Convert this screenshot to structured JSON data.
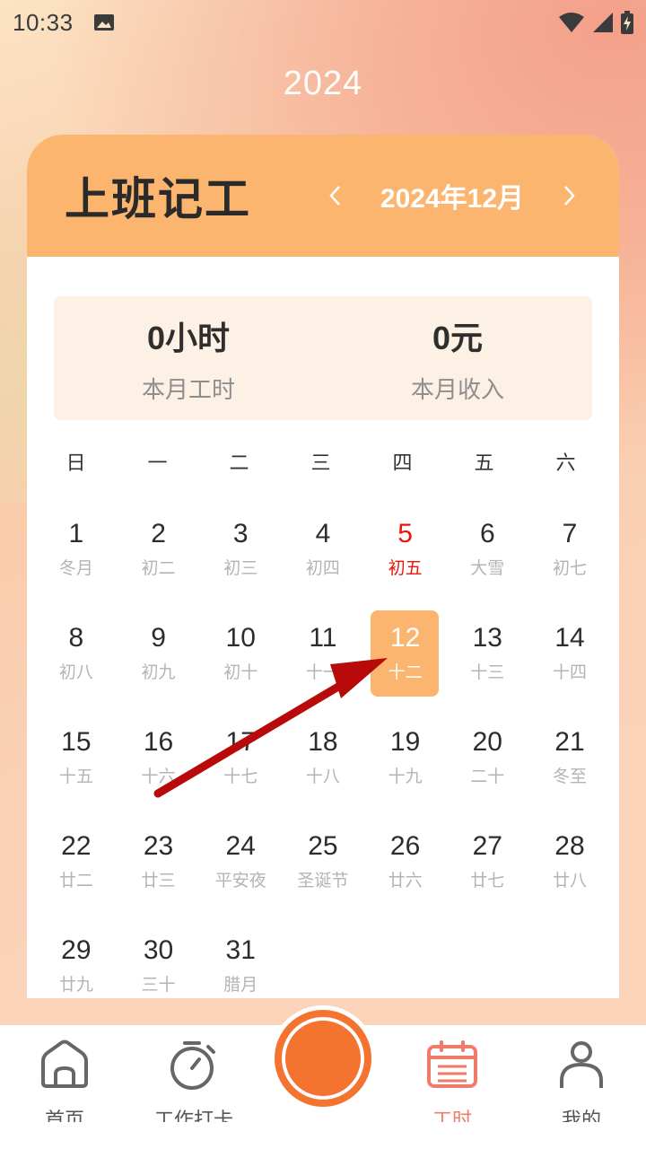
{
  "status": {
    "time": "10:33"
  },
  "year": "2024",
  "header": {
    "title": "上班记工",
    "month": "2024年12月"
  },
  "summary": {
    "hours_value": "0小时",
    "hours_label": "本月工时",
    "income_value": "0元",
    "income_label": "本月收入"
  },
  "weekdays": [
    "日",
    "一",
    "二",
    "三",
    "四",
    "五",
    "六"
  ],
  "days": [
    {
      "n": "1",
      "l": "冬月"
    },
    {
      "n": "2",
      "l": "初二"
    },
    {
      "n": "3",
      "l": "初三"
    },
    {
      "n": "4",
      "l": "初四"
    },
    {
      "n": "5",
      "l": "初五",
      "holiday": true
    },
    {
      "n": "6",
      "l": "大雪"
    },
    {
      "n": "7",
      "l": "初七"
    },
    {
      "n": "8",
      "l": "初八"
    },
    {
      "n": "9",
      "l": "初九"
    },
    {
      "n": "10",
      "l": "初十"
    },
    {
      "n": "11",
      "l": "十一"
    },
    {
      "n": "12",
      "l": "十二",
      "selected": true
    },
    {
      "n": "13",
      "l": "十三"
    },
    {
      "n": "14",
      "l": "十四"
    },
    {
      "n": "15",
      "l": "十五"
    },
    {
      "n": "16",
      "l": "十六"
    },
    {
      "n": "17",
      "l": "十七"
    },
    {
      "n": "18",
      "l": "十八"
    },
    {
      "n": "19",
      "l": "十九"
    },
    {
      "n": "20",
      "l": "二十"
    },
    {
      "n": "21",
      "l": "冬至"
    },
    {
      "n": "22",
      "l": "廿二"
    },
    {
      "n": "23",
      "l": "廿三"
    },
    {
      "n": "24",
      "l": "平安夜"
    },
    {
      "n": "25",
      "l": "圣诞节"
    },
    {
      "n": "26",
      "l": "廿六"
    },
    {
      "n": "27",
      "l": "廿七"
    },
    {
      "n": "28",
      "l": "廿八"
    },
    {
      "n": "29",
      "l": "廿九"
    },
    {
      "n": "30",
      "l": "三十"
    },
    {
      "n": "31",
      "l": "腊月"
    }
  ],
  "tabs": {
    "home": "首页",
    "clock": "工作打卡",
    "hours": "工时",
    "mine": "我的"
  },
  "colors": {
    "accent": "#fcb56f",
    "holiday": "#e8160c",
    "center_button": "#f4732f",
    "active_tab": "#f27a6a"
  }
}
